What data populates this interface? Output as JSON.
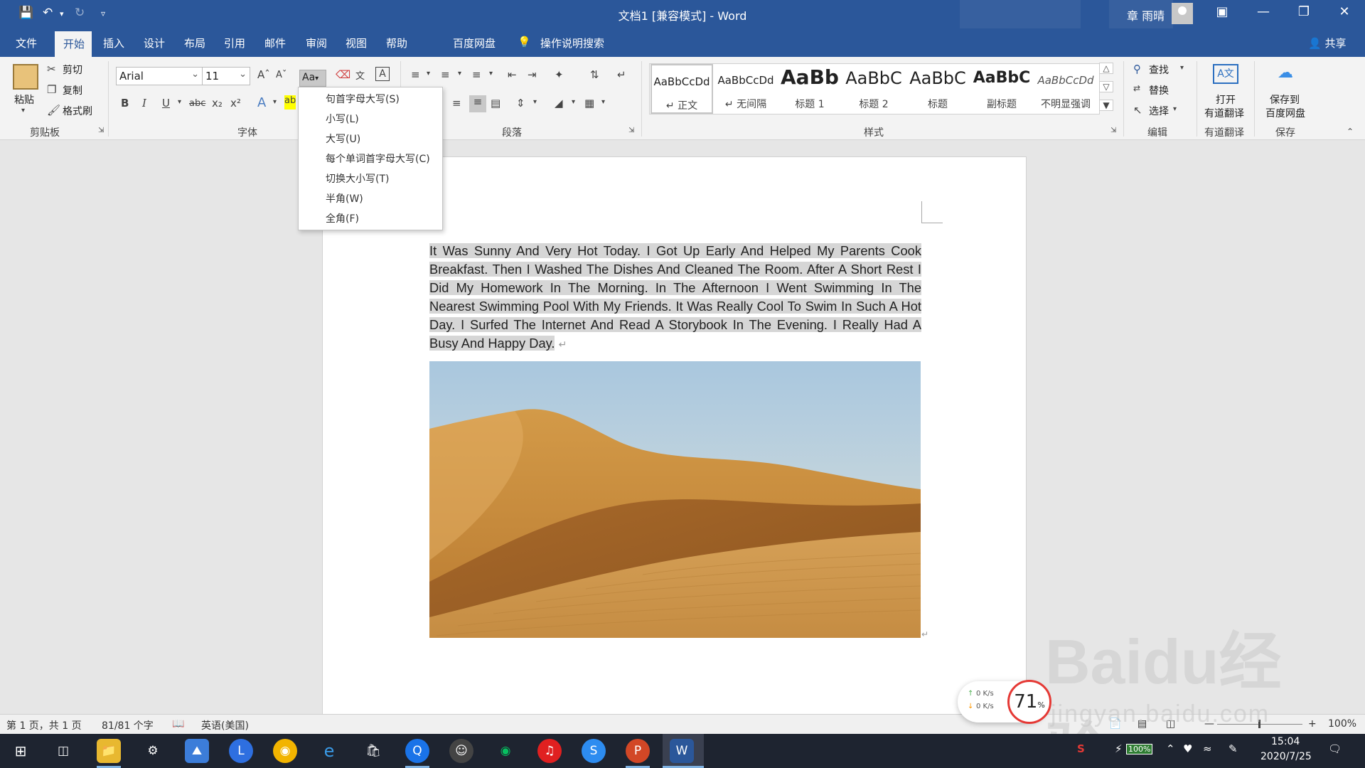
{
  "titlebar": {
    "doc_title": "文档1 [兼容模式]  -  Word",
    "user_name": "章 雨晴"
  },
  "tabs": [
    "文件",
    "开始",
    "插入",
    "设计",
    "布局",
    "引用",
    "邮件",
    "审阅",
    "视图",
    "帮助",
    "百度网盘",
    "操作说明搜索"
  ],
  "share_label": "共享",
  "clipboard": {
    "paste": "粘贴",
    "cut": "剪切",
    "copy": "复制",
    "format_painter": "格式刷",
    "group_label": "剪贴板"
  },
  "font": {
    "name": "Arial",
    "size": "11",
    "case_button": "Aa",
    "group_label": "字体"
  },
  "paragraph": {
    "group_label": "段落"
  },
  "styles": {
    "group_label": "样式",
    "items": [
      {
        "preview": "AaBbCcDd",
        "name": "↵ 正文"
      },
      {
        "preview": "AaBbCcDd",
        "name": "↵ 无间隔"
      },
      {
        "preview": "AaBb",
        "name": "标题 1"
      },
      {
        "preview": "AaBbC",
        "name": "标题 2"
      },
      {
        "preview": "AaBbC",
        "name": "标题"
      },
      {
        "preview": "AaBbC",
        "name": "副标题"
      },
      {
        "preview": "AaBbCcDd",
        "name": "不明显强调"
      }
    ]
  },
  "editing": {
    "find": "查找",
    "replace": "替换",
    "select": "选择",
    "group_label": "编辑"
  },
  "youdao": {
    "open_line1": "打开",
    "open_line2": "有道翻译",
    "group_label": "有道翻译"
  },
  "baidu": {
    "save_line1": "保存到",
    "save_line2": "百度网盘",
    "group_label": "保存"
  },
  "case_menu": [
    "句首字母大写(S)",
    "小写(L)",
    "大写(U)",
    "每个单词首字母大写(C)",
    "切换大小写(T)",
    "半角(W)",
    "全角(F)"
  ],
  "document": {
    "paragraph": "It Was Sunny And Very Hot Today. I Got Up Early And Helped My Parents Cook Breakfast. Then I Washed The Dishes And Cleaned The Room. After A Short Rest I Did My Homework In The Morning. In The Afternoon I Went Swimming In The Nearest Swimming Pool With My Friends. It Was Really Cool To Swim In Such A Hot Day. I Surfed The Internet And Read A Storybook In The Evening. I Really Had A Busy And Happy Day.",
    "para_mark": "↵"
  },
  "statusbar": {
    "page": "第 1 页，共 1 页",
    "words": "81/81 个字",
    "language": "英语(美国)",
    "zoom": "100%"
  },
  "taskbar": {
    "time": "15:04",
    "date": "2020/7/25",
    "battery": "100%"
  },
  "net_widget": {
    "up": "0  K/s",
    "down": "0  K/s",
    "percent": "71",
    "percent_unit": "%"
  },
  "watermark": {
    "main": "Baidu经验",
    "sub": "jingyan.baidu.com"
  },
  "colors": {
    "word_blue": "#2b579a",
    "ribbon_bg": "#f3f3f3",
    "selection": "#d6d6d6",
    "ring_red": "#e53935"
  }
}
